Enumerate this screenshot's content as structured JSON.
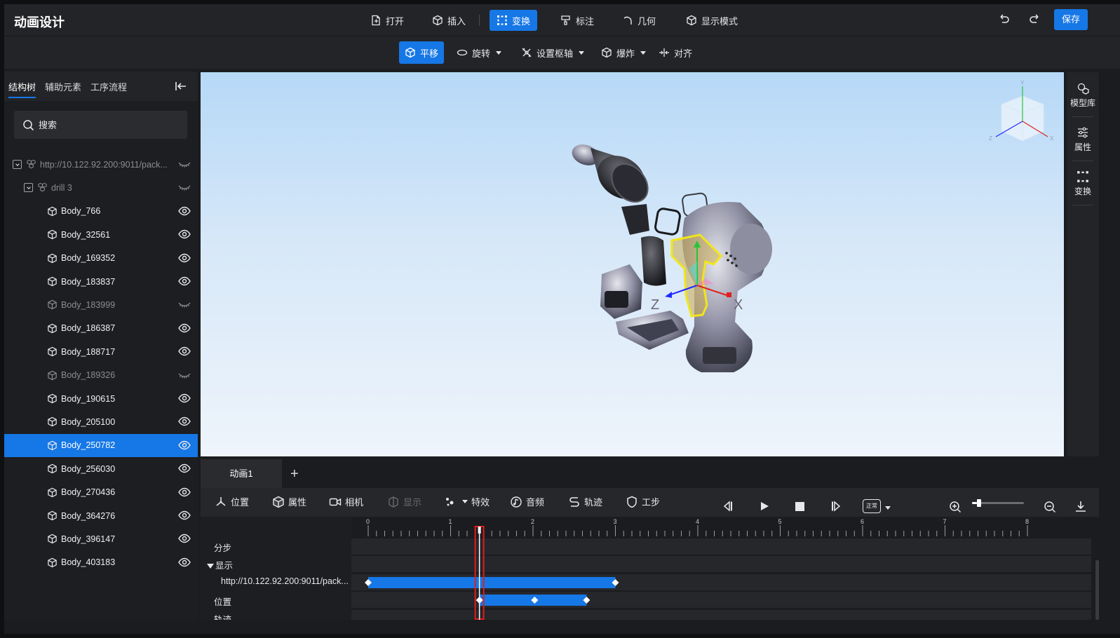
{
  "app": {
    "title": "动画设计"
  },
  "header": {
    "menus": [
      {
        "label": "打开",
        "icon": "file-open-icon"
      },
      {
        "label": "插入",
        "icon": "cube-insert-icon"
      },
      {
        "label": "变换",
        "icon": "transform-icon",
        "active": true
      },
      {
        "label": "标注",
        "icon": "annotation-icon"
      },
      {
        "label": "几何",
        "icon": "geometry-arc-icon"
      },
      {
        "label": "显示模式",
        "icon": "display-mode-icon"
      }
    ],
    "save_label": "保存"
  },
  "subtoolbar": {
    "items": [
      {
        "label": "平移",
        "icon": "translate-icon",
        "active": true
      },
      {
        "label": "旋转",
        "icon": "rotate-icon",
        "dropdown": true
      },
      {
        "label": "设置枢轴",
        "icon": "pivot-icon",
        "dropdown": true
      },
      {
        "label": "爆炸",
        "icon": "explode-icon",
        "dropdown": true
      },
      {
        "label": "对齐",
        "icon": "align-icon"
      }
    ]
  },
  "left_panel": {
    "tabs": [
      "结构树",
      "辅助元素",
      "工序流程"
    ],
    "search_placeholder": "搜索",
    "tree": [
      {
        "label": "http://10.122.92.200:9011/pack...",
        "level": 0,
        "expand": true,
        "visible": false,
        "dim": true
      },
      {
        "label": "drill 3",
        "level": 1,
        "expand": true,
        "visible": false,
        "dim": true
      },
      {
        "label": "Body_766",
        "level": 2,
        "visible": true
      },
      {
        "label": "Body_32561",
        "level": 2,
        "visible": true
      },
      {
        "label": "Body_169352",
        "level": 2,
        "visible": true
      },
      {
        "label": "Body_183837",
        "level": 2,
        "visible": true
      },
      {
        "label": "Body_183999",
        "level": 2,
        "visible": false,
        "dim": true
      },
      {
        "label": "Body_186387",
        "level": 2,
        "visible": true
      },
      {
        "label": "Body_188717",
        "level": 2,
        "visible": true
      },
      {
        "label": "Body_189326",
        "level": 2,
        "visible": false,
        "dim": true
      },
      {
        "label": "Body_190615",
        "level": 2,
        "visible": true
      },
      {
        "label": "Body_205100",
        "level": 2,
        "visible": true
      },
      {
        "label": "Body_250782",
        "level": 2,
        "visible": true,
        "selected": true
      },
      {
        "label": "Body_256030",
        "level": 2,
        "visible": true
      },
      {
        "label": "Body_270436",
        "level": 2,
        "visible": true
      },
      {
        "label": "Body_364276",
        "level": 2,
        "visible": true
      },
      {
        "label": "Body_396147",
        "level": 2,
        "visible": true
      },
      {
        "label": "Body_403183",
        "level": 2,
        "visible": true
      }
    ]
  },
  "viewport": {
    "gizmo_labels": {
      "z": "Z",
      "x": "X"
    },
    "viewcube_axes": {
      "x": "X",
      "y": "Y",
      "z": "Z"
    }
  },
  "right_panel": {
    "items": [
      {
        "label": "模型库",
        "icon": "model-library-icon"
      },
      {
        "label": "属性",
        "icon": "properties-sliders-icon"
      },
      {
        "label": "变换",
        "icon": "transform-icon"
      }
    ]
  },
  "animation": {
    "tabs": [
      "动画1"
    ],
    "add_tab": "+",
    "toolbar": [
      {
        "label": "位置",
        "icon": "position-axes-icon"
      },
      {
        "label": "属性",
        "icon": "cube-property-icon"
      },
      {
        "label": "相机",
        "icon": "camera-icon"
      },
      {
        "label": "显示",
        "icon": "display-icon",
        "disabled": true
      },
      {
        "label": "特效",
        "icon": "effects-icon",
        "dropdown": true
      },
      {
        "label": "音频",
        "icon": "audio-icon"
      },
      {
        "label": "轨迹",
        "icon": "track-path-icon"
      },
      {
        "label": "工步",
        "icon": "step-shield-icon"
      }
    ],
    "playback": [
      "step-back-icon",
      "play-icon",
      "stop-icon",
      "step-forward-icon"
    ],
    "speed_badge": "正常",
    "zoom_level": 0.1,
    "ruler_ticks": [
      "0",
      "1",
      "2",
      "3",
      "4",
      "5",
      "6",
      "7",
      "8"
    ],
    "tracks": [
      {
        "label": "分步"
      },
      {
        "label": "显示",
        "group": true
      },
      {
        "label": "http://10.122.92.200:9011/pack...",
        "sub": true
      },
      {
        "label": "位置"
      },
      {
        "label": "轨迹"
      }
    ],
    "bars": [
      {
        "track": 2,
        "start": 0,
        "end": 3.0,
        "keys": [
          0,
          3.0
        ]
      },
      {
        "track": 3,
        "start": 1.35,
        "end": 2.65,
        "keys": [
          1.35,
          2.02,
          2.65
        ]
      }
    ],
    "playhead": 1.35
  }
}
